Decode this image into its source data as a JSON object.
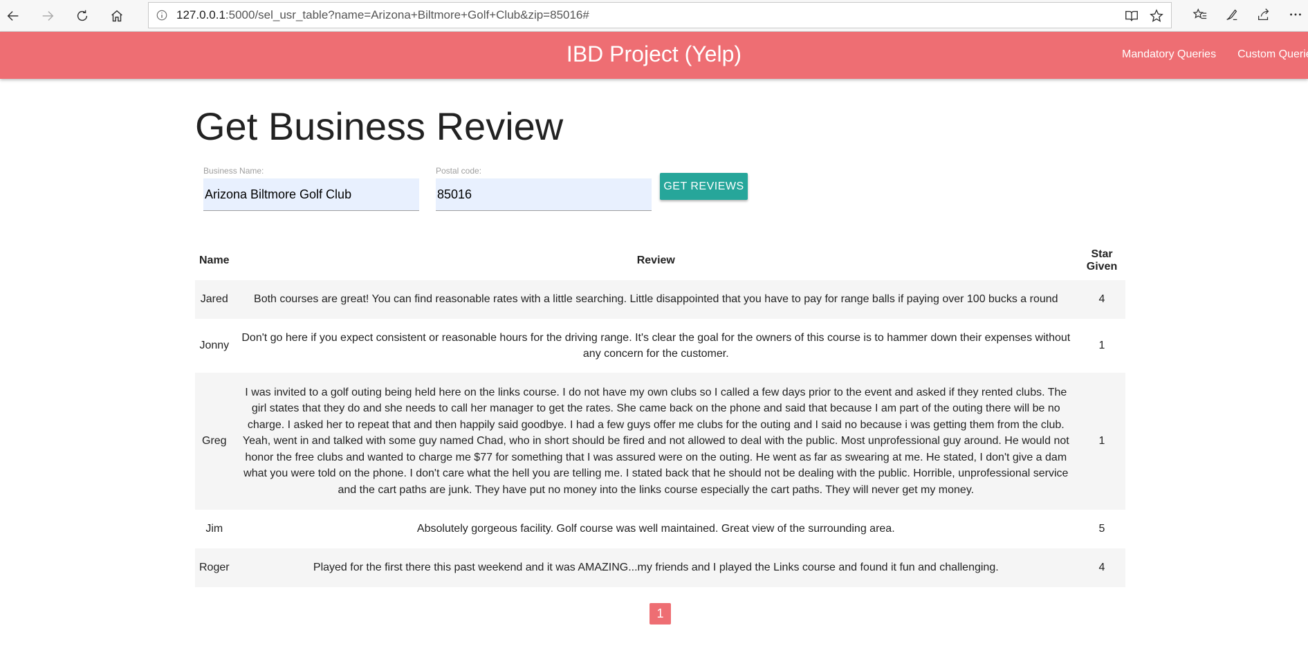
{
  "browser": {
    "url_host": "127.0.0.1",
    "url_rest": ":5000/sel_usr_table?name=Arizona+Biltmore+Golf+Club&zip=85016#"
  },
  "header": {
    "title": "IBD Project (Yelp)",
    "links": [
      "Mandatory Queries",
      "Custom Queries"
    ],
    "color": "#ee6e73"
  },
  "page": {
    "title": "Get Business Review"
  },
  "form": {
    "business_label": "Business Name:",
    "business_value": "Arizona Biltmore Golf Club",
    "postal_label": "Postal code:",
    "postal_value": "85016",
    "submit_label": "GET REVIEWS",
    "button_color": "#26a69a"
  },
  "table": {
    "headers": [
      "Name",
      "Review",
      "Star Given"
    ],
    "rows": [
      {
        "name": "Jared",
        "review": "Both courses are great! You can find reasonable rates with a little searching. Little disappointed that you have to pay for range balls if paying over 100 bucks a round",
        "stars": "4"
      },
      {
        "name": "Jonny",
        "review": "Don't go here if you expect consistent or reasonable hours for the driving range. It's clear the goal for the owners of this course is to hammer down their expenses without any concern for the customer.",
        "stars": "1"
      },
      {
        "name": "Greg",
        "review": "I was invited to a golf outing being held here on the links course. I do not have my own clubs so I called a few days prior to the event and asked if they rented clubs. The girl states that they do and she needs to call her manager to get the rates. She came back on the phone and said that because I am part of the outing there will be no charge. I asked her to repeat that and then happily said goodbye. I had a few guys offer me clubs for the outing and I said no because i was getting them from the club. Yeah, went in and talked with some guy named Chad, who in short should be fired and not allowed to deal with the public. Most unprofessional guy around. He would not honor the free clubs and wanted to charge me $77 for something that I was assured were on the outing. He went as far as swearing at me. He stated, I don't give a dam what you were told on the phone. I don't care what the hell you are telling me. I stated back that he should not be dealing with the public. Horrible, unprofessional service and the cart paths are junk. They have put no money into the links course especially the cart paths. They will never get my money.",
        "stars": "1"
      },
      {
        "name": "Jim",
        "review": "Absolutely gorgeous facility. Golf course was well maintained. Great view of the surrounding area.",
        "stars": "5"
      },
      {
        "name": "Roger",
        "review": "Played for the first there this past weekend and it was AMAZING...my friends and I played the Links course and found it fun and challenging.",
        "stars": "4"
      }
    ]
  },
  "pagination": {
    "current_page": "1"
  }
}
